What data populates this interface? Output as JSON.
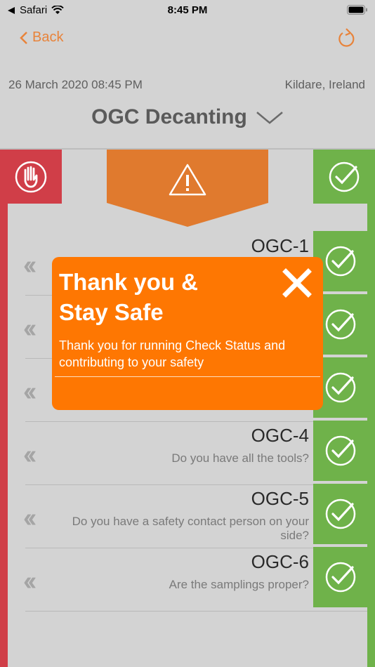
{
  "status_bar": {
    "carrier": "Safari",
    "time": "8:45 PM"
  },
  "nav": {
    "back_label": "Back"
  },
  "header": {
    "date": "26 March 2020 08:45 PM",
    "location": "Kildare, Ireland",
    "title": "OGC Decanting"
  },
  "rows": [
    {
      "code": "OGC-1",
      "question": ""
    },
    {
      "code": "",
      "question": ""
    },
    {
      "code": "",
      "question": ""
    },
    {
      "code": "OGC-4",
      "question": "Do you have all the tools?"
    },
    {
      "code": "OGC-5",
      "question": "Do you have a safety contact person on your side?"
    },
    {
      "code": "OGC-6",
      "question": "Are the samplings proper?"
    }
  ],
  "popup": {
    "title_line1": "Thank you &",
    "title_line2": "Stay Safe",
    "message": "Thank you for running Check Status and contributing to your safety"
  },
  "colors": {
    "accent": "#e8833a",
    "popup": "#fe7702",
    "red": "#d03e48",
    "green": "#6fb24a",
    "warning": "#e07a2e"
  },
  "icons": [
    "wifi-icon",
    "battery-icon",
    "chevron-left-icon",
    "refresh-icon",
    "chevron-down-icon",
    "hand-stop-icon",
    "warning-icon",
    "check-circle-icon",
    "double-chevron-left-icon",
    "close-icon"
  ]
}
